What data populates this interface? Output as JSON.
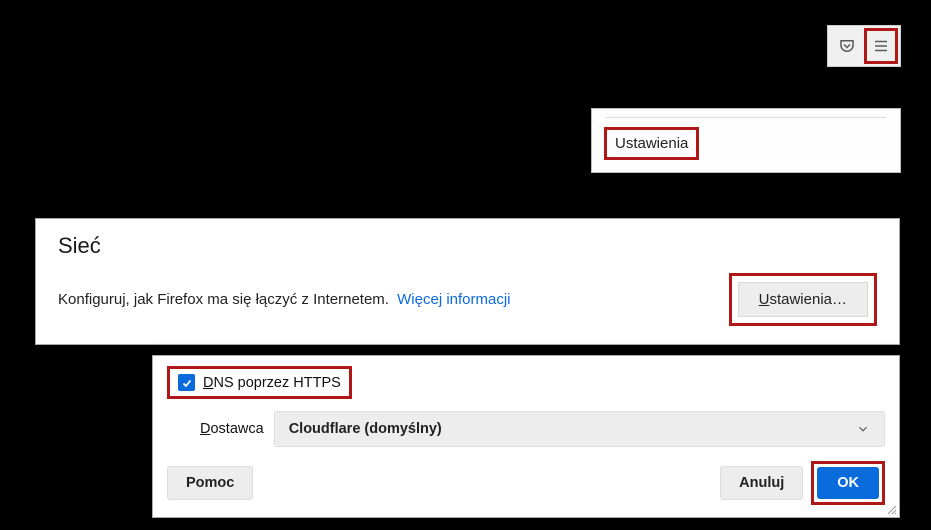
{
  "toolbar": {
    "pocket_icon": "pocket-icon",
    "hamburger_icon": "menu-icon"
  },
  "dropdown": {
    "settings_label": "Ustawienia"
  },
  "siec": {
    "title": "Sieć",
    "desc": "Konfiguruj, jak Firefox ma się łączyć z Internetem.",
    "more_info": "Więcej informacji",
    "settings_btn_u": "U",
    "settings_btn_rest": "stawienia…"
  },
  "dns": {
    "checkbox_checked": true,
    "check_u": "D",
    "check_rest": "NS poprzez HTTPS",
    "provider_u": "D",
    "provider_rest": "ostawca",
    "provider_value": "Cloudflare (domyślny)",
    "help": "Pomoc",
    "cancel": "Anuluj",
    "ok": "OK"
  }
}
